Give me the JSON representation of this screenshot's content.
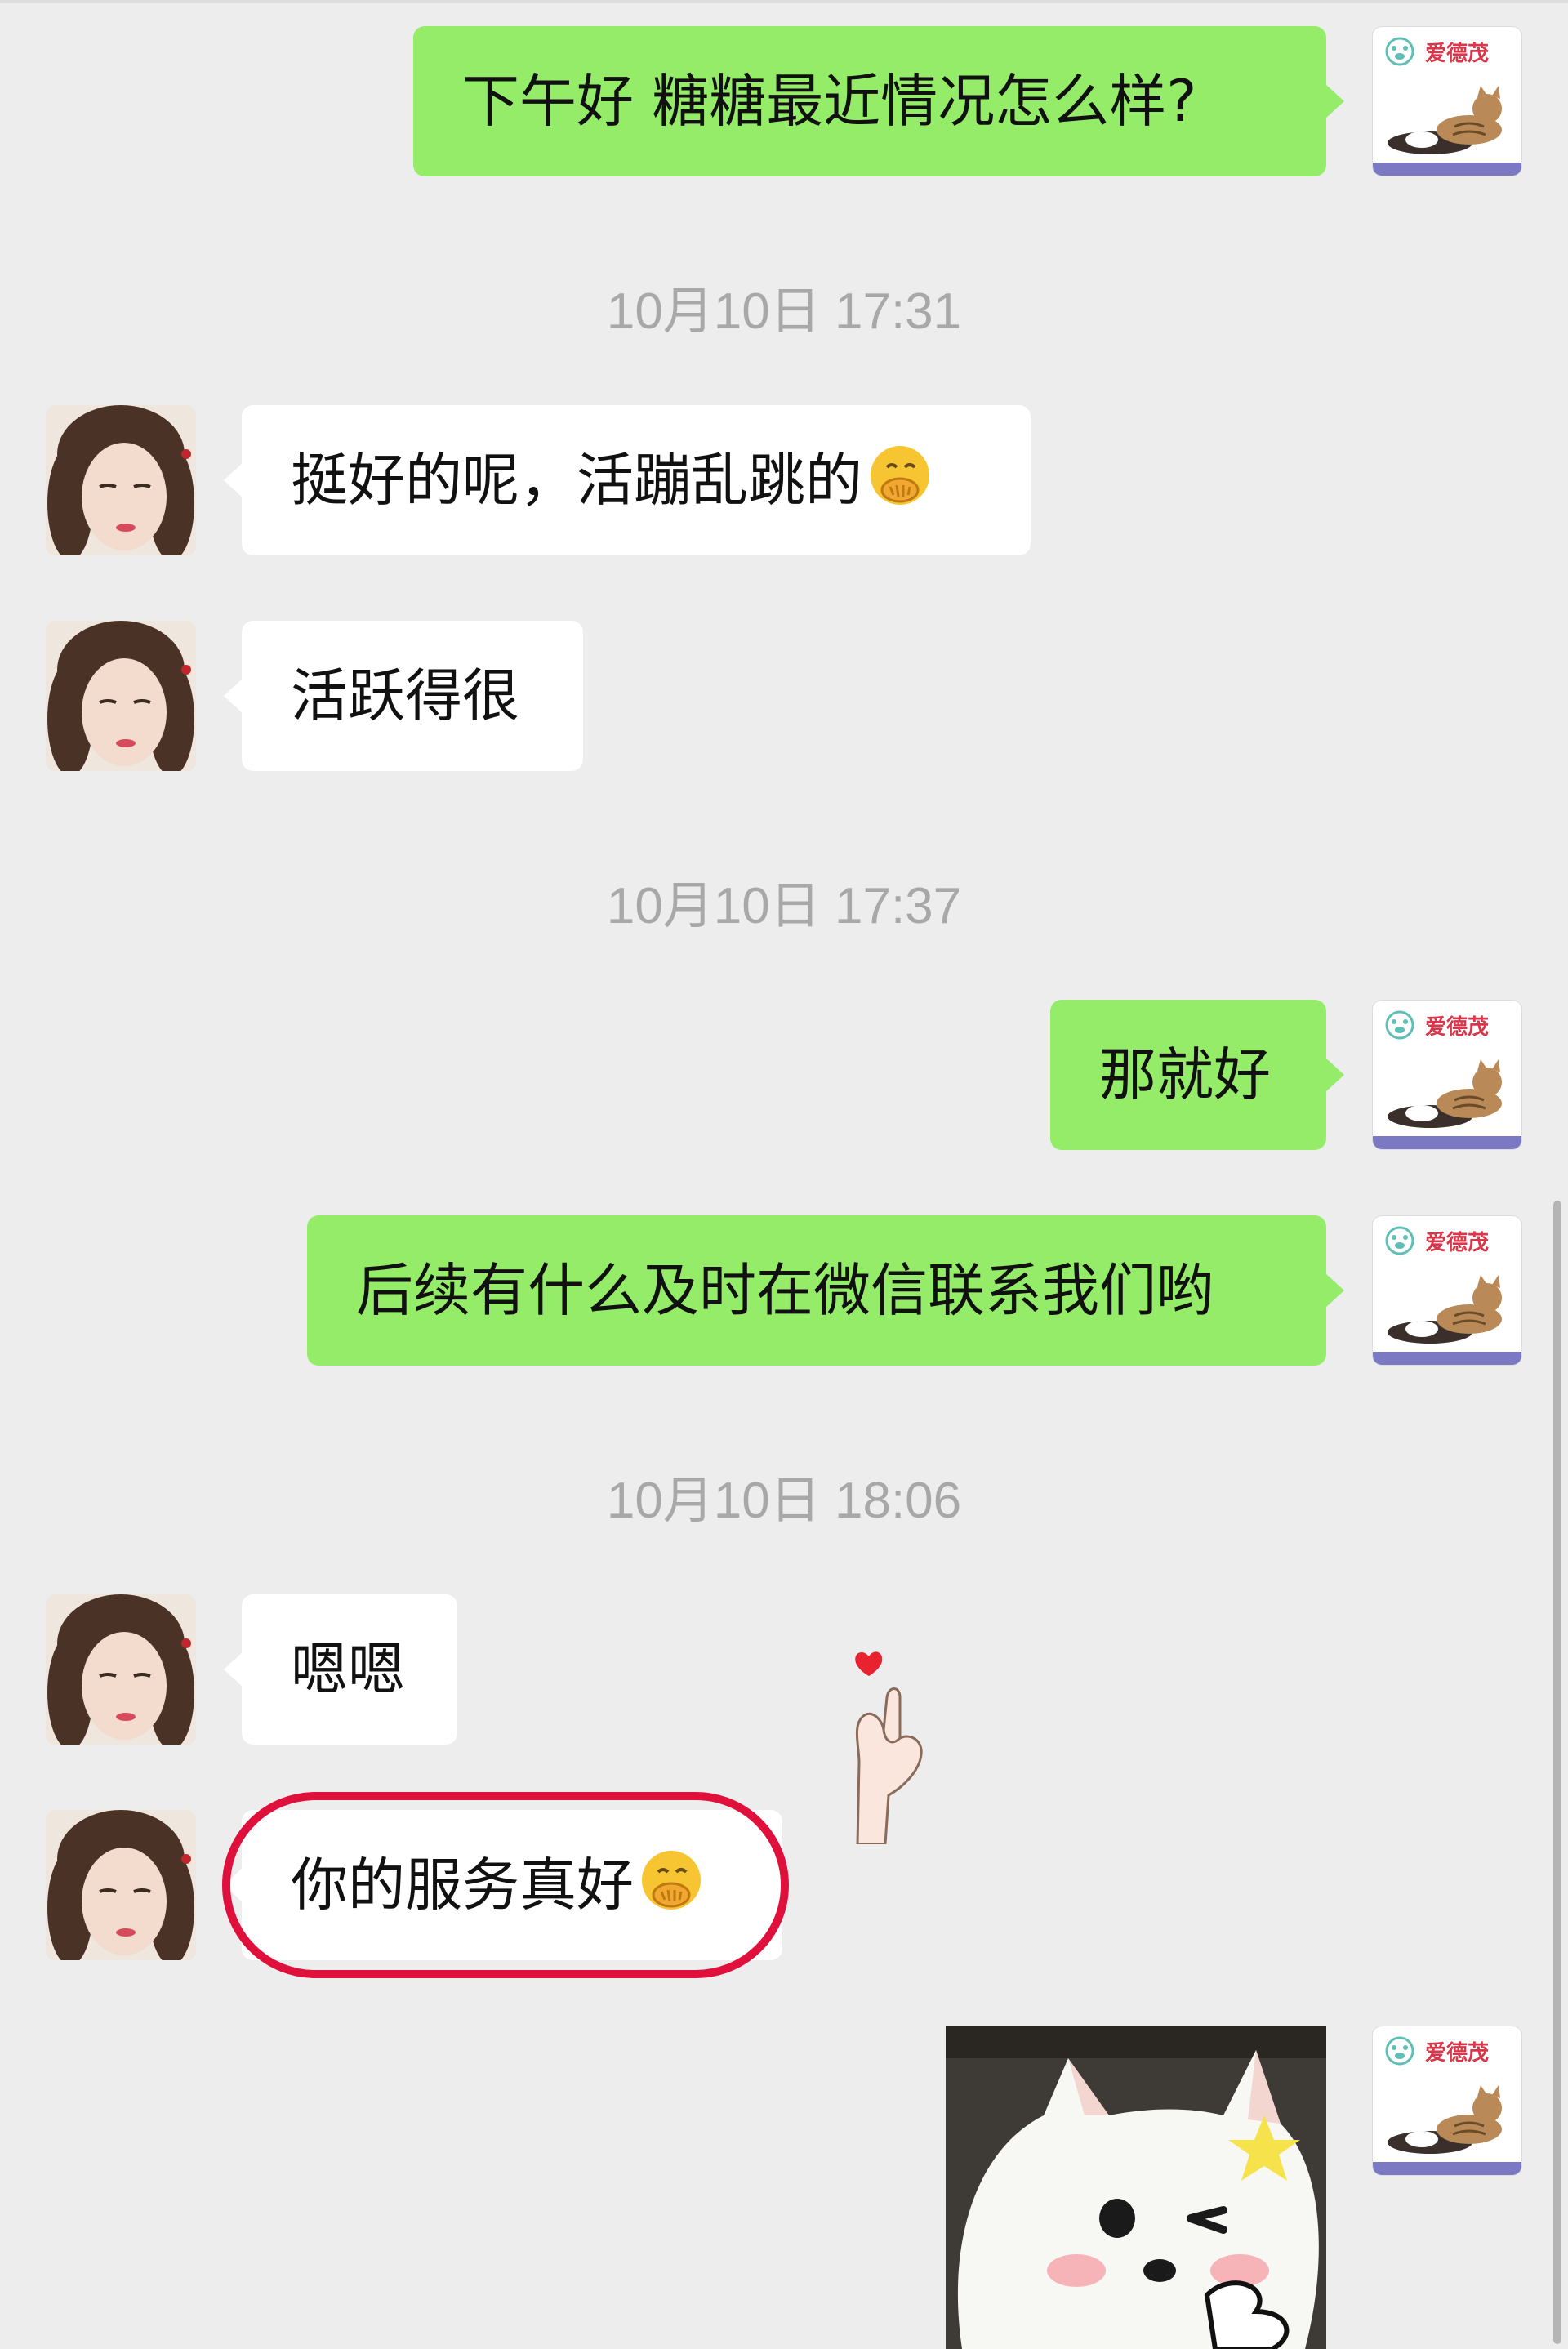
{
  "colors": {
    "background": "#ededed",
    "sent_bubble": "#95ec69",
    "received_bubble": "#ffffff",
    "timestamp_text": "#a8a8a8",
    "highlight_ring": "#e0103c"
  },
  "shop_avatar": {
    "brand_text": "爱德茂",
    "icon": "shop-logo-cat-dog"
  },
  "user_avatar": {
    "icon": "user-photo-avatar"
  },
  "messages": [
    {
      "direction": "sent",
      "text": "下午好  糖糖最近情况怎么样?"
    },
    {
      "type": "timestamp",
      "text": "10月10日 17:31"
    },
    {
      "direction": "received",
      "text": "挺好的呢，活蹦乱跳的",
      "emoji": "hand-over-mouth-emoji"
    },
    {
      "direction": "received",
      "text": "活跃得很"
    },
    {
      "type": "timestamp",
      "text": "10月10日 17:37"
    },
    {
      "direction": "sent",
      "text": "那就好"
    },
    {
      "direction": "sent",
      "text": "后续有什么及时在微信联系我们哟"
    },
    {
      "type": "timestamp",
      "text": "10月10日 18:06"
    },
    {
      "direction": "received",
      "text": "嗯嗯"
    },
    {
      "direction": "received",
      "text": "你的服务真好",
      "emoji": "hand-over-mouth-emoji",
      "highlighted": true
    },
    {
      "direction": "sent",
      "type": "sticker",
      "sticker": "white-puppy-wink-sticker"
    }
  ],
  "overlay_sticker": {
    "icon": "finger-heart-icon"
  }
}
